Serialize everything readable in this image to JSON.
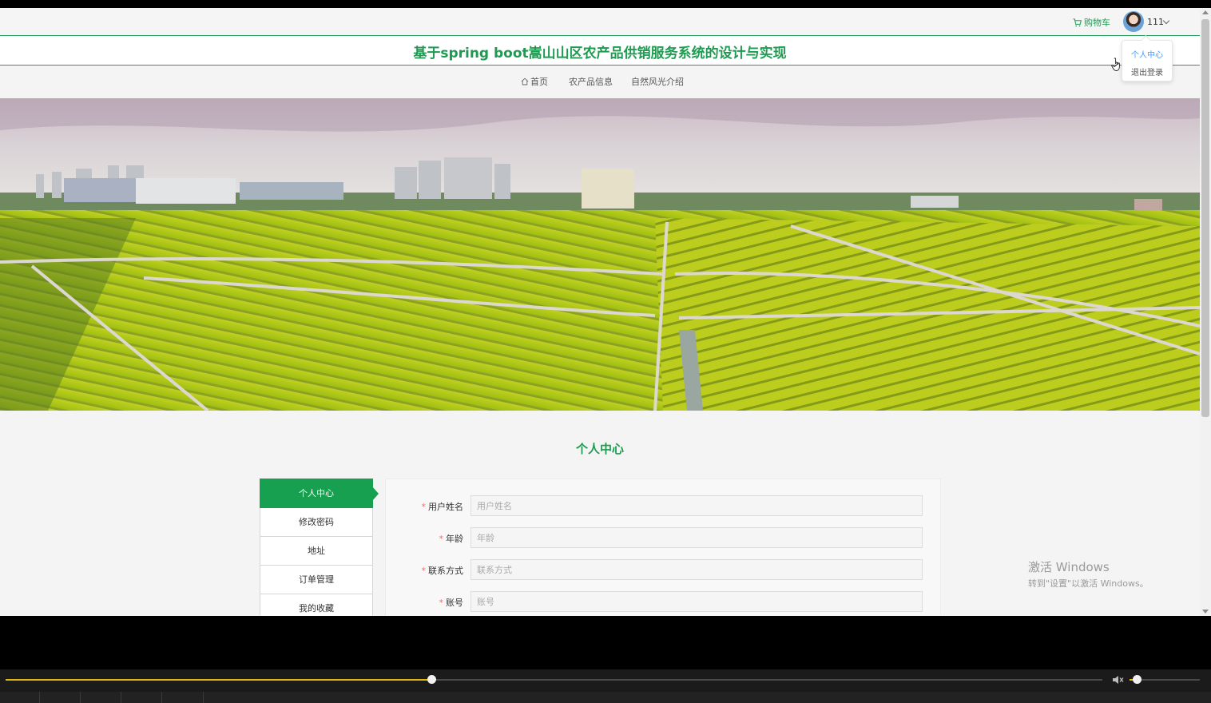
{
  "header": {
    "cart_label": "购物车",
    "user_name": "111",
    "site_title": "基于spring boot嵩山山区农产品供销服务系统的设计与实现"
  },
  "nav": {
    "items": [
      "首页",
      "农产品信息",
      "自然风光介绍"
    ]
  },
  "user_dropdown": {
    "items": [
      "个人中心",
      "退出登录"
    ],
    "active_index": 0
  },
  "section": {
    "title": "个人中心"
  },
  "side_menu": {
    "items": [
      "个人中心",
      "修改密码",
      "地址",
      "订单管理",
      "我的收藏"
    ],
    "active_index": 0
  },
  "form": {
    "fields": [
      {
        "label": "用户姓名",
        "placeholder": "用户姓名",
        "required": true
      },
      {
        "label": "年龄",
        "placeholder": "年龄",
        "required": true
      },
      {
        "label": "联系方式",
        "placeholder": "联系方式",
        "required": true
      },
      {
        "label": "账号",
        "placeholder": "账号",
        "required": true
      }
    ],
    "required_mark": "*"
  },
  "watermark": {
    "line1": "激活 Windows",
    "line2": "转到\"设置\"以激活 Windows。"
  },
  "player": {
    "progress": 0.388,
    "volume": 0.1
  },
  "colors": {
    "brand_green": "#1e9b50",
    "active_green": "#17a04f",
    "required_red": "#f56c6c",
    "player_accent": "#e3b40d",
    "dropdown_active": "#409eff"
  }
}
